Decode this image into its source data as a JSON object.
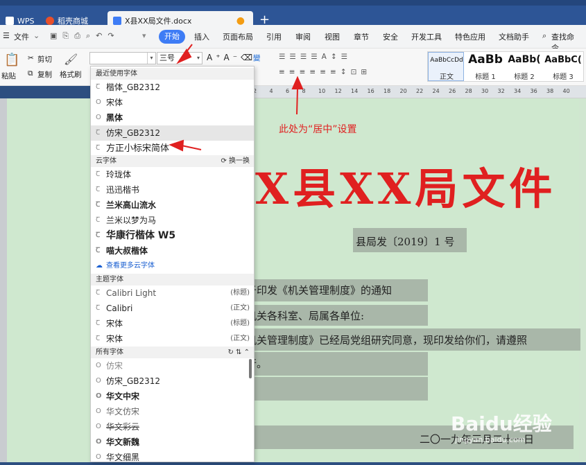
{
  "tabs": [
    {
      "label": "WPS"
    },
    {
      "label": "稻壳商城"
    },
    {
      "label": "X县XX局文件.docx"
    }
  ],
  "menu": {
    "file": "文件",
    "start": "开始",
    "items": [
      "插入",
      "页面布局",
      "引用",
      "审阅",
      "视图",
      "章节",
      "安全",
      "开发工具",
      "特色应用",
      "文档助手"
    ],
    "search": "查找命令、"
  },
  "ribbon": {
    "paste": "粘贴",
    "cut": "剪切",
    "copy": "复制",
    "format_painter": "格式刷",
    "font_size": "三号",
    "styles": [
      {
        "preview": "AaBbCcDd",
        "label": "正文"
      },
      {
        "preview": "AaBb",
        "label": "标题 1"
      },
      {
        "preview": "AaBb(",
        "label": "标题 2"
      },
      {
        "preview": "AaBbC(",
        "label": "标题 3"
      }
    ]
  },
  "ruler": [
    "2",
    "4",
    "6",
    "8",
    "10",
    "12",
    "14",
    "16",
    "18",
    "20",
    "22",
    "24",
    "26",
    "28",
    "30",
    "32",
    "34",
    "36",
    "38",
    "40"
  ],
  "font_dropdown": {
    "recent_header": "最近使用字体",
    "recent": [
      "楷体_GB2312",
      "宋体",
      "黑体",
      "仿宋_GB2312",
      "方正小标宋简体"
    ],
    "cloud_header": "云字体",
    "cloud_switch": "换一换",
    "cloud": [
      "玲珑体",
      "迅迅楷书",
      "兰米高山流水",
      "兰米以梦为马",
      "华康行楷体 W5",
      "喵大叔楷体"
    ],
    "more_cloud": "查看更多云字体",
    "theme_header": "主题字体",
    "theme": [
      {
        "name": "Calibri Light",
        "tag": "(标题)"
      },
      {
        "name": "Calibri",
        "tag": "(正文)"
      },
      {
        "name": "宋体",
        "tag": "(标题)"
      },
      {
        "name": "宋体",
        "tag": "(正文)"
      }
    ],
    "all_header": "所有字体",
    "all": [
      "仿宋",
      "仿宋_GB2312",
      "华文中宋",
      "华文仿宋",
      "华文彩云",
      "华文新魏",
      "华文细黑"
    ]
  },
  "doc": {
    "title": "X县XX局文件",
    "number": "县局发〔2019〕1 号",
    "line1": "于印发《机关管理制度》的通知",
    "line2": "机关各科室、局属各单位:",
    "line3": "机关管理制度》已经局党组研究同意，现印发给你们，请遵照",
    "line4": "行。",
    "date": "二〇一九年三月二十一日"
  },
  "annotation": "此处为“居中”设置",
  "watermark": {
    "brand": "Baidu经验",
    "url": "jingyan.baidu.com"
  }
}
